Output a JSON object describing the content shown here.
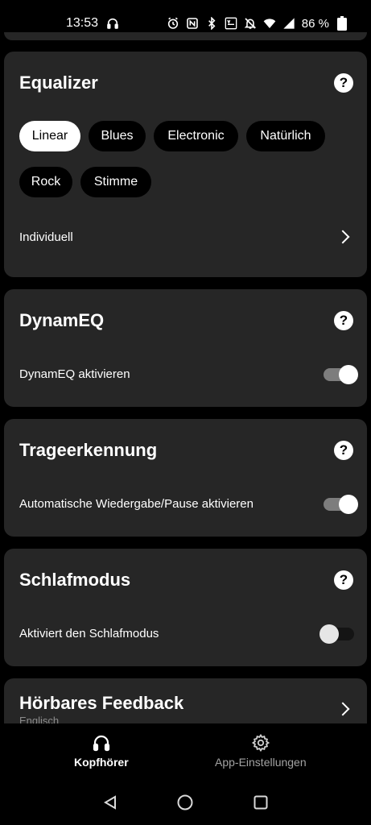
{
  "status_bar": {
    "time": "13:53",
    "battery": "86 %"
  },
  "equalizer": {
    "title": "Equalizer",
    "presets": [
      "Linear",
      "Blues",
      "Electronic",
      "Natürlich",
      "Rock",
      "Stimme"
    ],
    "selected": "Linear",
    "custom_label": "Individuell"
  },
  "dynameq": {
    "title": "DynamEQ",
    "toggle_label": "DynamEQ aktivieren",
    "enabled": true
  },
  "wear_detection": {
    "title": "Trageerkennung",
    "toggle_label": "Automatische Wiedergabe/Pause aktivieren",
    "enabled": true
  },
  "sleep_mode": {
    "title": "Schlafmodus",
    "toggle_label": "Aktiviert den Schlafmodus",
    "enabled": false
  },
  "audible_feedback": {
    "title": "Hörbares Feedback",
    "value": "Englisch"
  },
  "help_glyph": "?",
  "bottom_nav": {
    "headphones_label": "Kopfhörer",
    "app_settings_label": "App-Einstellungen",
    "active": "Kopfhörer"
  },
  "colors": {
    "background": "#000000",
    "card": "#262626",
    "toggle_track_on": "#7d7d7d",
    "inactive_text": "#a3a3a3"
  }
}
